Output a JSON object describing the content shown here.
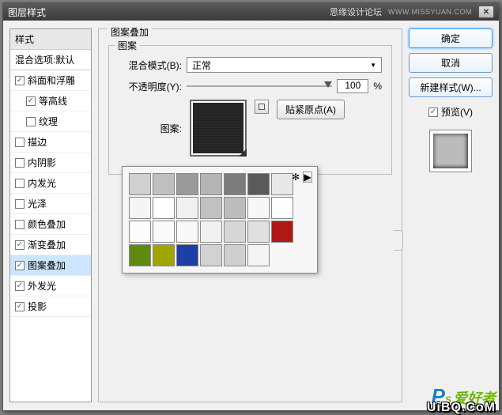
{
  "titlebar": {
    "title": "图层样式",
    "brand": "思缘设计论坛",
    "url": "WWW.MISSYUAN.COM"
  },
  "left": {
    "header": "样式",
    "sub": "混合选项:默认",
    "items": [
      {
        "label": "斜面和浮雕",
        "checked": true,
        "indent": false
      },
      {
        "label": "等高线",
        "checked": true,
        "indent": true
      },
      {
        "label": "纹理",
        "checked": false,
        "indent": true
      },
      {
        "label": "描边",
        "checked": false,
        "indent": false
      },
      {
        "label": "内阴影",
        "checked": false,
        "indent": false
      },
      {
        "label": "内发光",
        "checked": false,
        "indent": false
      },
      {
        "label": "光泽",
        "checked": false,
        "indent": false
      },
      {
        "label": "颜色叠加",
        "checked": false,
        "indent": false
      },
      {
        "label": "渐变叠加",
        "checked": true,
        "indent": false
      },
      {
        "label": "图案叠加",
        "checked": true,
        "indent": false,
        "selected": true
      },
      {
        "label": "外发光",
        "checked": true,
        "indent": false
      },
      {
        "label": "投影",
        "checked": true,
        "indent": false
      }
    ]
  },
  "mid": {
    "group_title": "图案叠加",
    "inner_title": "图案",
    "blend_label": "混合模式(B):",
    "blend_value": "正常",
    "opacity_label": "不透明度(Y):",
    "opacity_value": "100",
    "percent": "%",
    "pattern_label": "图案:",
    "snap_label": "贴紧原点(A)"
  },
  "right": {
    "ok": "确定",
    "cancel": "取消",
    "new_style": "新建样式(W)...",
    "preview_label": "预览(V)"
  },
  "picker": {
    "swatches": [
      "#d0d0d0",
      "#bfbfbf",
      "#9a9a9a",
      "#b4b4b4",
      "#7c7c7c",
      "#5a5a5a",
      "#e8e8e8",
      "#f5f5f5",
      "#ffffff",
      "#f0f0f0",
      "#c1c1c1",
      "#bcbcbc",
      "#f7f7f7",
      "#fefefe",
      "#fcfcfc",
      "#fafafa",
      "#f8f8f8",
      "#f1f1f1",
      "#d6d6d6",
      "#e0e0e0",
      "#b01818",
      "#5f8a12",
      "#a0a600",
      "#1d3fa6",
      "#d2d2d2",
      "#cfcfcf",
      "#f4f4f4"
    ]
  },
  "watermark": {
    "url": "UiBQ.CoM"
  }
}
